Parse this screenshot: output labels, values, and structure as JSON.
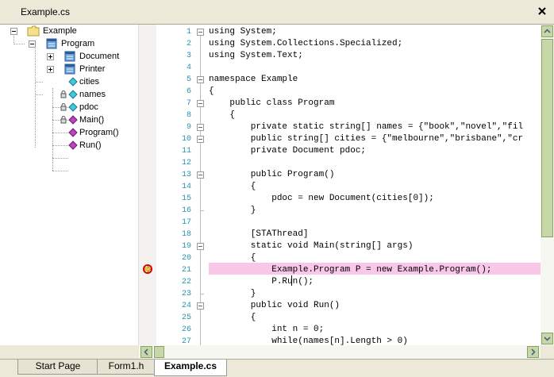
{
  "window": {
    "title": "Example.cs"
  },
  "tree": [
    {
      "label": "Example",
      "icon": "folder-icon"
    },
    {
      "label": "Program",
      "icon": "class-icon"
    },
    {
      "label": "Document",
      "icon": "class-icon"
    },
    {
      "label": "Printer",
      "icon": "class-icon"
    },
    {
      "label": "cities",
      "icon": "field-icon"
    },
    {
      "label": "names",
      "icon": "field-icon"
    },
    {
      "label": "pdoc",
      "icon": "field-icon"
    },
    {
      "label": "Main()",
      "icon": "method-icon"
    },
    {
      "label": "Program()",
      "icon": "method-icon"
    },
    {
      "label": "Run()",
      "icon": "method-icon"
    }
  ],
  "code": {
    "line_numbers": [
      "1",
      "2",
      "3",
      "4",
      "5",
      "6",
      "7",
      "8",
      "9",
      "10",
      "11",
      "12",
      "13",
      "14",
      "15",
      "16",
      "17",
      "18",
      "19",
      "20",
      "21",
      "22",
      "23",
      "24",
      "25",
      "26",
      "27"
    ],
    "lines": [
      "using System;",
      "using System.Collections.Specialized;",
      "using System.Text;",
      "",
      "namespace Example",
      "{",
      "    public class Program",
      "    {",
      "        private static string[] names = {\"book\",\"novel\",\"fil",
      "        public string[] cities = {\"melbourne\",\"brisbane\",\"cr",
      "        private Document pdoc;",
      "",
      "        public Program()",
      "        {",
      "            pdoc = new Document(cities[0]);",
      "        }",
      "",
      "        [STAThread]",
      "        static void Main(string[] args)",
      "        {",
      "            Example.Program P = new Example.Program();",
      "            P.Run();",
      "        }",
      "        public void Run()",
      "        {",
      "            int n = 0;",
      "            while(names[n].Length > 0)"
    ],
    "current_line": 21
  },
  "tabs": [
    {
      "label": "Start Page"
    },
    {
      "label": "Form1.h"
    },
    {
      "label": "Example.cs"
    }
  ],
  "colors": {
    "line_number": "#2b91af",
    "highlight": "#f9c8e8",
    "scroll_accent": "#c6d8a8"
  }
}
